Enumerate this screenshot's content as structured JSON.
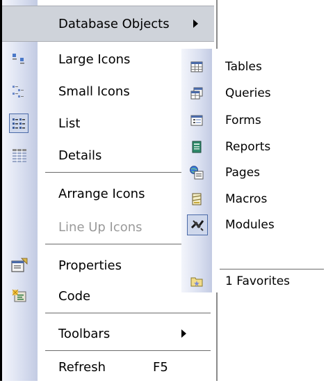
{
  "main_menu": {
    "header": {
      "label": "Database Objects"
    },
    "items": [
      {
        "label": "Large Icons",
        "icon": "large-icons-icon"
      },
      {
        "label": "Small Icons",
        "icon": "small-icons-icon"
      },
      {
        "label": "List",
        "icon": "list-view-icon"
      },
      {
        "label": "Details",
        "icon": "details-view-icon"
      },
      {
        "label": "Arrange Icons"
      },
      {
        "label": "Line Up Icons"
      },
      {
        "label": "Properties",
        "icon": "properties-icon"
      },
      {
        "label": "Code",
        "icon": "code-icon"
      },
      {
        "label": "Toolbars"
      },
      {
        "label": "Refresh",
        "shortcut": "F5"
      }
    ]
  },
  "submenu": {
    "items": [
      {
        "label": "Tables",
        "icon": "table-icon"
      },
      {
        "label": "Queries",
        "icon": "query-icon"
      },
      {
        "label": "Forms",
        "icon": "form-icon"
      },
      {
        "label": "Reports",
        "icon": "report-icon"
      },
      {
        "label": "Pages",
        "icon": "page-icon"
      },
      {
        "label": "Macros",
        "icon": "macro-icon"
      },
      {
        "label": "Modules",
        "icon": "module-icon"
      },
      {
        "label": "1 Favorites",
        "icon": "favorites-icon"
      }
    ]
  },
  "colors": {
    "gutter": "#c3cbe3",
    "highlight": "#cfd3da",
    "disabled_text": "#9a9a9a"
  }
}
